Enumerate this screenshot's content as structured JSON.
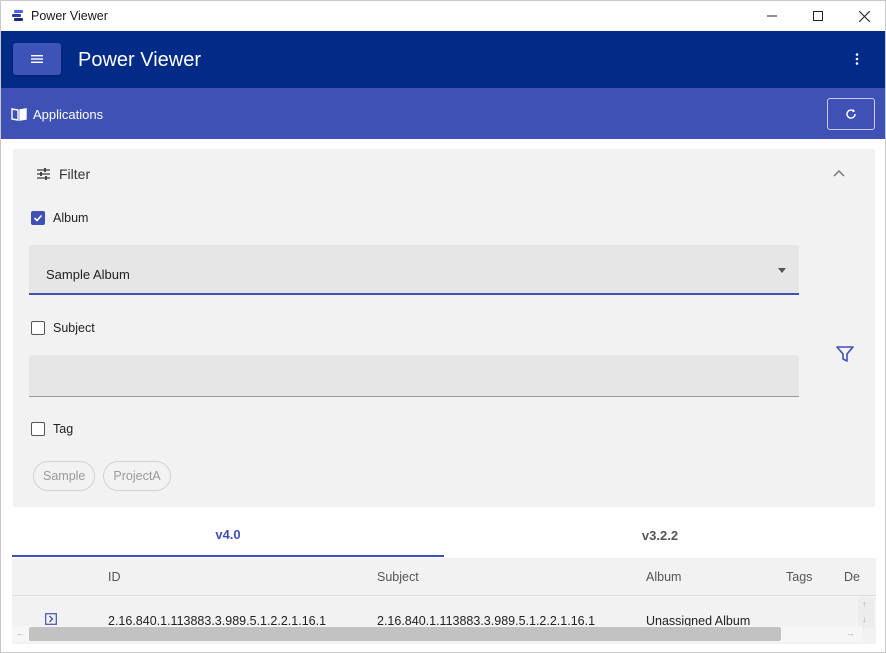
{
  "window": {
    "title": "Power Viewer"
  },
  "appbar": {
    "title": "Power Viewer"
  },
  "subbar": {
    "title": "Applications"
  },
  "filter": {
    "header_label": "Filter",
    "album": {
      "label": "Album",
      "checked": true,
      "selected_value": "Sample Album"
    },
    "subject": {
      "label": "Subject",
      "checked": false,
      "value": ""
    },
    "tag": {
      "label": "Tag",
      "checked": false
    },
    "chips": [
      "Sample",
      "ProjectA"
    ]
  },
  "tabs": [
    {
      "label": "v4.0",
      "active": true
    },
    {
      "label": "v3.2.2",
      "active": false
    }
  ],
  "table": {
    "columns": [
      "ID",
      "Subject",
      "Album",
      "Tags",
      "De"
    ],
    "rows": [
      {
        "id": "2.16.840.1.113883.3.989.5.1.2.2.1.16.1",
        "subject": "2.16.840.1.113883.3.989.5.1.2.2.1.16.1",
        "album": "Unassigned Album",
        "tags": ""
      }
    ]
  },
  "colors": {
    "appbar": "#022a87",
    "subbar": "#3f51b5",
    "accent": "#3f51b5",
    "panel": "#f2f2f2"
  },
  "icons": {
    "app": "app-logo-icon",
    "menu": "hamburger-menu-icon",
    "more": "more-vertical-icon",
    "section": "book-open-icon",
    "refresh": "refresh-icon",
    "filter_header": "sliders-icon",
    "collapse": "chevron-up-icon",
    "apply_filter": "filter-funnel-icon",
    "row_expand": "expand-row-icon"
  }
}
